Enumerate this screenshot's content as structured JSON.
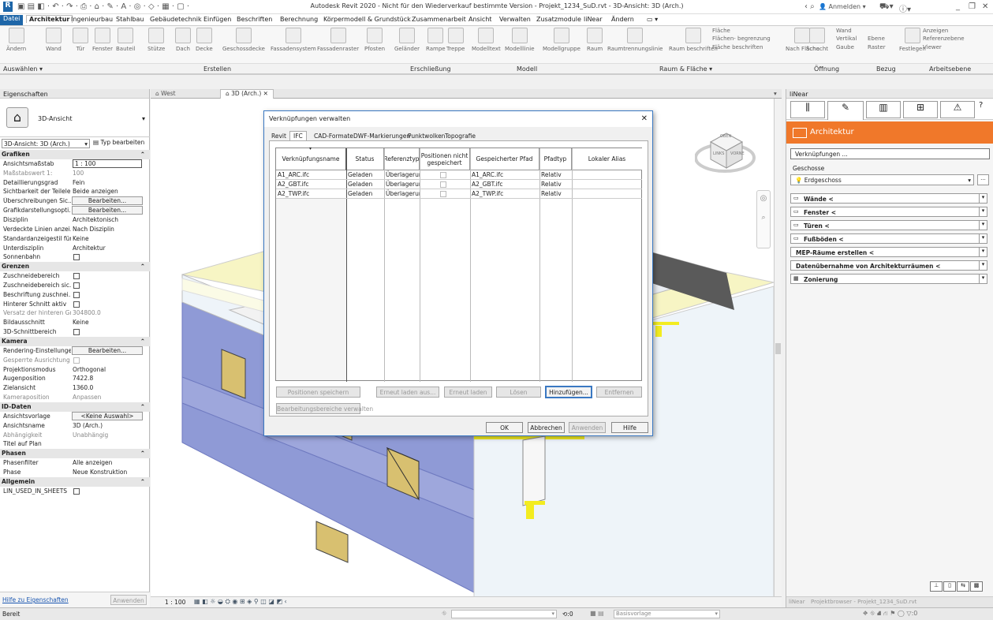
{
  "window": {
    "title": "Autodesk Revit 2020 - Nicht für den Wiederverkauf bestimmte Version - Projekt_1234_SuD.rvt - 3D-Ansicht: 3D (Arch.)",
    "signin": "Anmelden"
  },
  "menu": [
    "Datei",
    "Architektur",
    "Ingenieurbau",
    "Stahlbau",
    "Gebäudetechnik",
    "Einfügen",
    "Beschriften",
    "Berechnung",
    "Körpermodell & Grundstück",
    "Zusammenarbeit",
    "Ansicht",
    "Verwalten",
    "Zusatzmodule",
    "liNear",
    "Ändern"
  ],
  "ribbon": {
    "buttons": [
      "Ändern",
      "Wand",
      "Tür",
      "Fenster",
      "Bauteil",
      "Stütze",
      "Dach",
      "Decke",
      "Geschossdecke",
      "Fassadensystem",
      "Fassadenraster",
      "Pfosten",
      "Geländer",
      "Rampe",
      "Treppe",
      "Modelltext",
      "Modelllinie",
      "Modellgruppe",
      "Raum",
      "Raumtrennungslinie",
      "Raum beschriften",
      "Fläche",
      "Flächen- begrenzung",
      "Fläche beschriften",
      "Nach Fläche",
      "Schacht",
      "Wand",
      "Vertikal",
      "Gaube",
      "Ebene",
      "Raster",
      "Festlegen",
      "Anzeigen",
      "Referenzebene",
      "Viewer"
    ],
    "groups": [
      "Auswählen ▾",
      "Erstellen",
      "Erschließung",
      "Modell",
      "Raum & Fläche ▾",
      "Öffnung",
      "Bezug",
      "Arbeitsebene"
    ]
  },
  "properties": {
    "header": "Eigenschaften",
    "type_name": "3D-Ansicht",
    "selector": "3D-Ansicht: 3D (Arch.)",
    "edit_type": "Typ bearbeiten",
    "rows": [
      {
        "k": "Grafiken",
        "sec": true
      },
      {
        "k": "Ansichtsmaßstab",
        "v": "1 : 100",
        "input": true
      },
      {
        "k": "Maßstabswert 1:",
        "v": "100",
        "grey": true
      },
      {
        "k": "Detaillierungsgrad",
        "v": "Fein"
      },
      {
        "k": "Sichtbarkeit der Teilele...",
        "v": "Beide anzeigen"
      },
      {
        "k": "Überschreibungen Sic...",
        "b": "Bearbeiten..."
      },
      {
        "k": "Grafikdarstellungsopti...",
        "b": "Bearbeiten..."
      },
      {
        "k": "Disziplin",
        "v": "Architektonisch"
      },
      {
        "k": "Verdeckte Linien anzei...",
        "v": "Nach Disziplin"
      },
      {
        "k": "Standardanzeigestil für...",
        "v": "Keine"
      },
      {
        "k": "Unterdisziplin",
        "v": "Architektur"
      },
      {
        "k": "Sonnenbahn",
        "c": true
      },
      {
        "k": "Grenzen",
        "sec": true
      },
      {
        "k": "Zuschneidebereich",
        "c": true
      },
      {
        "k": "Zuschneidebereich sic...",
        "c": true
      },
      {
        "k": "Beschriftung zuschnei...",
        "c": true
      },
      {
        "k": "Hinterer Schnitt aktiv",
        "c": true
      },
      {
        "k": "Versatz der hinteren Gr...",
        "v": "304800.0",
        "grey": true
      },
      {
        "k": "Bildausschnitt",
        "v": "Keine"
      },
      {
        "k": "3D-Schnittbereich",
        "c": true
      },
      {
        "k": "Kamera",
        "sec": true
      },
      {
        "k": "Rendering-Einstellungen",
        "b": "Bearbeiten..."
      },
      {
        "k": "Gesperrte Ausrichtung",
        "c": true,
        "grey": true
      },
      {
        "k": "Projektionsmodus",
        "v": "Orthogonal"
      },
      {
        "k": "Augenposition",
        "v": "7422.8"
      },
      {
        "k": "Zielansicht",
        "v": "1360.0"
      },
      {
        "k": "Kameraposition",
        "v": "Anpassen",
        "grey": true
      },
      {
        "k": "ID-Daten",
        "sec": true
      },
      {
        "k": "Ansichtsvorlage",
        "b": "<Keine Auswahl>"
      },
      {
        "k": "Ansichtsname",
        "v": "3D (Arch.)"
      },
      {
        "k": "Abhängigkeit",
        "v": "Unabhängig",
        "grey": true
      },
      {
        "k": "Titel auf Plan",
        "v": ""
      },
      {
        "k": "Phasen",
        "sec": true
      },
      {
        "k": "Phasenfilter",
        "v": "Alle anzeigen"
      },
      {
        "k": "Phase",
        "v": "Neue Konstruktion"
      },
      {
        "k": "Allgemein",
        "sec": true
      },
      {
        "k": "LIN_USED_IN_SHEETS",
        "c": true
      }
    ],
    "help_link": "Hilfe zu Eigenschaften",
    "apply": "Anwenden"
  },
  "view_tabs": [
    "West",
    "3D (Arch.)"
  ],
  "viewcube": {
    "top": "OBEN",
    "left": "LINKS",
    "front": "VORNE"
  },
  "view_bar": {
    "scale": "1 : 100"
  },
  "dialog": {
    "title": "Verknüpfungen verwalten",
    "tabs": [
      "Revit",
      "IFC",
      "CAD-Formate",
      "DWF-Markierungen",
      "Punktwolken",
      "Topografie"
    ],
    "columns": [
      "Verknüpfungsname",
      "Status",
      "Referenztyp",
      "Positionen nicht gespeichert",
      "Gespeicherter Pfad",
      "Pfadtyp",
      "Lokaler Alias"
    ],
    "rows": [
      {
        "name": "A1_ARC.ifc",
        "status": "Geladen",
        "ref": "Überlagerun",
        "path": "A1_ARC.ifc",
        "ptype": "Relativ"
      },
      {
        "name": "A2_GBT.ifc",
        "status": "Geladen",
        "ref": "Überlagerun",
        "path": "A2_GBT.ifc",
        "ptype": "Relativ"
      },
      {
        "name": "A2_TWP.ifc",
        "status": "Geladen",
        "ref": "Überlagerun",
        "path": "A2_TWP.ifc",
        "ptype": "Relativ"
      }
    ],
    "btn_save": "Positionen speichern",
    "btn_reload_from": "Erneut laden aus...",
    "btn_reload": "Erneut laden",
    "btn_unload": "Lösen",
    "btn_add": "Hinzufügen...",
    "btn_remove": "Entfernen",
    "btn_worksets": "Bearbeitungsbereiche verwalten",
    "btn_ok": "OK",
    "btn_cancel": "Abbrechen",
    "btn_apply": "Anwenden",
    "btn_help": "Hilfe"
  },
  "linear": {
    "header": "liNear",
    "title": "Architektur",
    "links_btn": "Verknüpfungen ...",
    "level_label": "Geschosse",
    "level": "Erdgeschoss",
    "items": [
      "Wände <",
      "Fenster <",
      "Türen <",
      "Fußböden <",
      "MEP-Räume erstellen <",
      "Datenübernahme von Architekturräumen <",
      "Zonierung"
    ],
    "tabs": [
      "liNear",
      "Projektbrowser - Projekt_1234_SuD.rvt"
    ]
  },
  "status": {
    "text": "Bereit",
    "filter": ":0",
    "template": "Basisvorlage",
    "sel": ":0"
  },
  "colors": {
    "wall_side": "#8f9ad6",
    "wall_front": "#eef4f9",
    "accent": "#3a78c2",
    "floor": "#f7f5c4",
    "yellow": "#f3ec20",
    "linear_orange": "#f0782a"
  }
}
